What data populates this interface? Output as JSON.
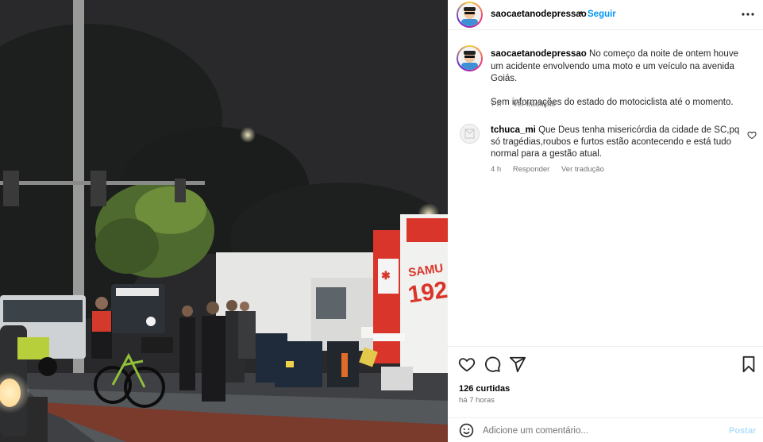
{
  "post": {
    "username": "saocaetanodepressao",
    "dot": "•",
    "follow_label": "Seguir"
  },
  "caption": {
    "username": "saocaetanodepressao",
    "text": "No começo da noite de ontem houve um acidente envolvendo uma moto e um veículo na avenida Goiás.",
    "text2": "Sem informações do estado do motociclista até o momento.",
    "time": "7 h",
    "translate_label": "Ver tradução"
  },
  "comments": [
    {
      "username": "tchuca_mi",
      "text": "Que Deus tenha misericórdia da cidade de SC,pq só tragédias,roubos e furtos estão acontecendo e está tudo normal para a gestão atual.",
      "time": "4 h",
      "reply_label": "Responder",
      "translate_label": "Ver tradução"
    }
  ],
  "actions": {
    "likes": "126 curtidas",
    "posted_ago": "há 7 horas"
  },
  "add_comment": {
    "placeholder": "Adicione um comentário...",
    "post_label": "Postar"
  },
  "photo": {
    "ambulance_text": "SAMU",
    "ambulance_number": "192",
    "icons": [
      "heart-icon",
      "comment-icon",
      "share-icon",
      "bookmark-icon",
      "more-icon",
      "emoji-icon"
    ]
  },
  "colors": {
    "link": "#0095f6",
    "muted": "#737373",
    "ambulance_red": "#d9352b"
  }
}
